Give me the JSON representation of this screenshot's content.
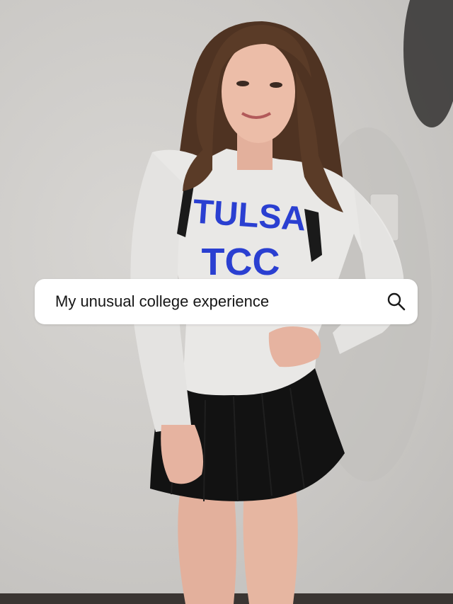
{
  "search": {
    "query": "My unusual college experience"
  },
  "shirt": {
    "text_line1": "TULSA",
    "text_line2": "TCC"
  },
  "icons": {
    "search": "search-icon"
  },
  "colors": {
    "wall": "#cfcdca",
    "shirt": "#e9e8e6",
    "shirt_print": "#2a3fd1",
    "skirt": "#111111",
    "hair": "#5a3b27",
    "skin": "#e9b9a3",
    "search_bg": "#ffffff",
    "search_text": "#161616"
  }
}
